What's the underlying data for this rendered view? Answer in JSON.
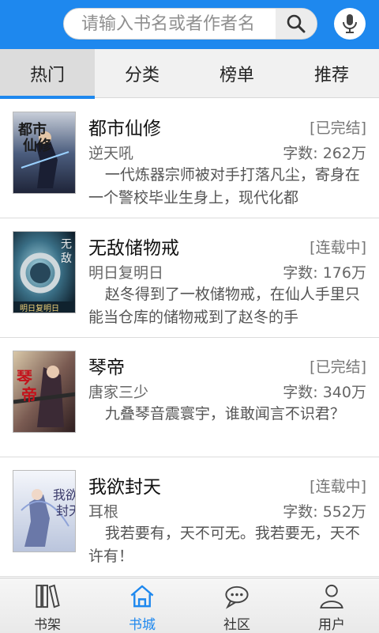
{
  "search": {
    "placeholder": "请输入书名或者作者名"
  },
  "icons": {
    "search": "search-icon",
    "mic": "microphone-icon",
    "bookshelf": "bookshelf-icon",
    "bookstore": "home-icon",
    "community": "chat-bubble-icon",
    "user": "user-icon"
  },
  "tabs": [
    {
      "label": "热门",
      "active": true
    },
    {
      "label": "分类",
      "active": false
    },
    {
      "label": "榜单",
      "active": false
    },
    {
      "label": "推荐",
      "active": false
    }
  ],
  "books": [
    {
      "title": "都市仙修",
      "status": "[已完结]",
      "author": "逆天吼",
      "words": "字数: 262万",
      "desc": "一代炼器宗师被对手打落凡尘，寄身在一个警校毕业生身上，现代化都"
    },
    {
      "title": "无敌储物戒",
      "status": "[连载中]",
      "author": "明日复明日",
      "words": "字数: 176万",
      "desc": "赵冬得到了一枚储物戒，在仙人手里只能当仓库的储物戒到了赵冬的手"
    },
    {
      "title": "琴帝",
      "status": "[已完结]",
      "author": "唐家三少",
      "words": "字数: 340万",
      "desc": "九叠琴音震寰宇，谁敢闻言不识君？"
    },
    {
      "title": "我欲封天",
      "status": "[连载中]",
      "author": "耳根",
      "words": "字数: 552万",
      "desc": "我若要有，天不可无。我若要无，天不许有！"
    }
  ],
  "bottom_nav": [
    {
      "label": "书架",
      "active": false
    },
    {
      "label": "书城",
      "active": true
    },
    {
      "label": "社区",
      "active": false
    },
    {
      "label": "用户",
      "active": false
    }
  ],
  "colors": {
    "brand_blue": "#1e88ee",
    "tab_bg": "#f1f1f1",
    "tab_active_bg": "#dcdcdc"
  }
}
